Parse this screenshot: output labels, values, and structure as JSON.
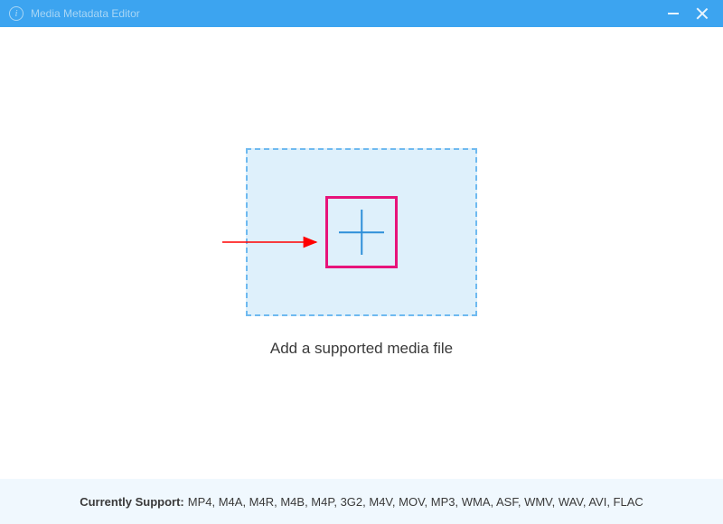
{
  "titlebar": {
    "title": "Media Metadata Editor"
  },
  "main": {
    "dropzone_label": "Add a supported media file"
  },
  "footer": {
    "label": "Currently Support:",
    "formats": "MP4, M4A, M4R, M4B, M4P, 3G2, M4V, MOV, MP3, WMA, ASF, WMV, WAV, AVI, FLAC"
  }
}
